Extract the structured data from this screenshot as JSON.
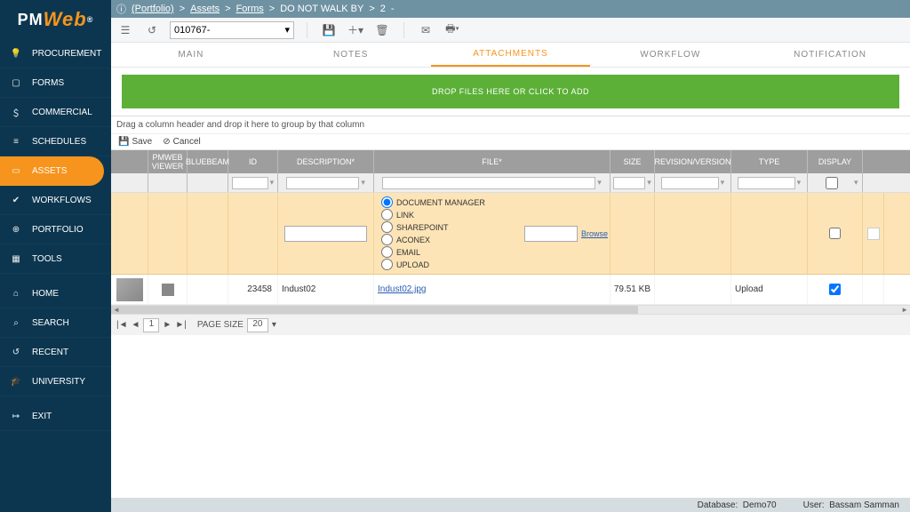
{
  "logo": {
    "pm": "PM",
    "web": "Web",
    "reg": "®"
  },
  "breadcrumb": {
    "info": "ⓘ",
    "portfolio": "(Portfolio)",
    "s1": ">",
    "assets": "Assets",
    "s2": ">",
    "forms": "Forms",
    "s3": ">",
    "title": "DO NOT WALK BY",
    "s4": ">",
    "num": "2",
    "s5": "-"
  },
  "toolbar": {
    "combo": "010767-"
  },
  "sidebar": {
    "items": [
      {
        "icon": "bulb",
        "label": "PROCUREMENT"
      },
      {
        "icon": "doc",
        "label": "FORMS"
      },
      {
        "icon": "dollar",
        "label": "COMMERCIAL"
      },
      {
        "icon": "bars",
        "label": "SCHEDULES"
      },
      {
        "icon": "tablet",
        "label": "ASSETS",
        "active": true
      },
      {
        "icon": "check",
        "label": "WORKFLOWS"
      },
      {
        "icon": "globe",
        "label": "PORTFOLIO"
      },
      {
        "icon": "case",
        "label": "TOOLS"
      },
      {
        "sep": true
      },
      {
        "icon": "home",
        "label": "HOME"
      },
      {
        "icon": "search",
        "label": "SEARCH"
      },
      {
        "icon": "recent",
        "label": "RECENT"
      },
      {
        "icon": "grad",
        "label": "UNIVERSITY"
      },
      {
        "sep": true
      },
      {
        "icon": "exit",
        "label": "EXIT"
      }
    ]
  },
  "tabs": [
    "MAIN",
    "NOTES",
    "ATTACHMENTS",
    "WORKFLOW",
    "NOTIFICATION"
  ],
  "activeTab": 2,
  "dropzone": "DROP FILES HERE OR CLICK TO ADD",
  "grouphint": "Drag a column header and drop it here to group by that column",
  "gridtb": {
    "save": "Save",
    "cancel": "Cancel"
  },
  "cols": {
    "pm": "PMWEB VIEWER",
    "bb": "BLUEBEAM",
    "id": "ID",
    "desc": "DESCRIPTION*",
    "file": "FILE*",
    "size": "SIZE",
    "rev": "REVISION/VERSION",
    "type": "TYPE",
    "disp": "DISPLAY"
  },
  "radios": [
    "DOCUMENT MANAGER",
    "LINK",
    "SHAREPOINT",
    "ACONEX",
    "EMAIL",
    "UPLOAD"
  ],
  "browse": "Browse",
  "row": {
    "id": "23458",
    "desc": "Indust02",
    "file": "Indust02.jpg",
    "size": "79.51 KB",
    "type": "Upload"
  },
  "pager": {
    "pagesize_label": "PAGE SIZE",
    "pagesize": "20",
    "page": "1"
  },
  "footer": {
    "db_label": "Database:",
    "db": "Demo70",
    "user_label": "User:",
    "user": "Bassam Samman"
  }
}
